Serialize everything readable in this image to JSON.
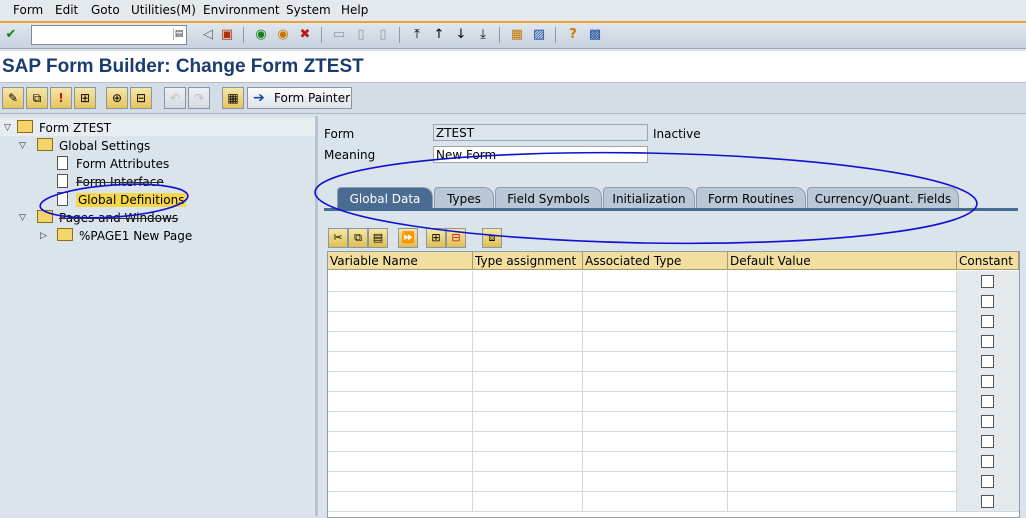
{
  "menu": [
    {
      "label": "Form",
      "u": "F",
      "rest": "orm"
    },
    {
      "label": "Edit",
      "u": "E",
      "rest": "dit"
    },
    {
      "label": "Goto",
      "u": "G",
      "rest": "oto"
    },
    {
      "label": "Utilities(M)",
      "u": "U",
      "rest": "tilities(M)"
    },
    {
      "label": "Environment",
      "u": "E",
      "rest": "nvironment"
    },
    {
      "label": "System",
      "u": "S",
      "rest": "ystem"
    },
    {
      "label": "Help",
      "u": "H",
      "rest": "elp"
    }
  ],
  "command_field": {
    "value": ""
  },
  "title": "SAP Form Builder: Change Form ZTEST",
  "app_toolbar": {
    "form_painter_label": "Form Painter"
  },
  "tree": {
    "root": "Form ZTEST",
    "global_settings": "Global Settings",
    "form_attributes": "Form Attributes",
    "form_interface": "Form Interface",
    "global_definitions": "Global Definitions",
    "pages_and_windows": "Pages and Windows",
    "page1": "%PAGE1 New Page"
  },
  "form_header": {
    "form_label": "Form",
    "form_value": "ZTEST",
    "status": "Inactive",
    "meaning_label": "Meaning",
    "meaning_value": "New Form"
  },
  "tabs": [
    "Global Data",
    "Types",
    "Field Symbols",
    "Initialization",
    "Form Routines",
    "Currency/Quant. Fields"
  ],
  "active_tab": "Global Data",
  "table": {
    "columns": [
      "Variable Name",
      "Type assignment",
      "Associated Type",
      "Default Value",
      "Constant"
    ],
    "rows": 12
  },
  "colors": {
    "accent": "#f0a030",
    "title": "#1a3c6e",
    "tab_active": "#4a6c93",
    "annotation": "#1010d0"
  }
}
